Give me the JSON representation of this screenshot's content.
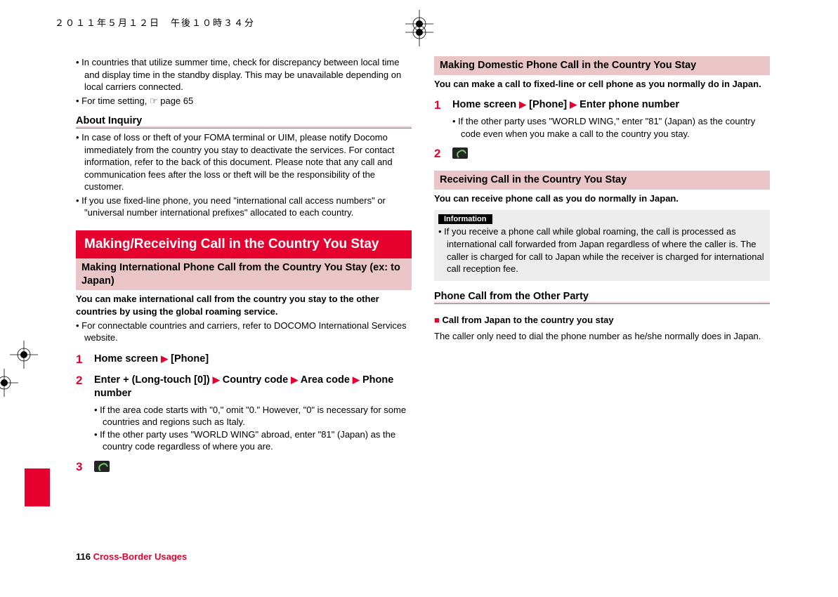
{
  "header": {
    "timestamp": "２０１１年５月１２日　午後１０時３４分"
  },
  "left": {
    "intro_bullets": [
      "In countries that utilize summer time, check for discrepancy between local time and display time in the standby display. This may be unavailable depending on local carriers connected.",
      "For time setting, ☞ page 65"
    ],
    "about_inquiry_h": "About Inquiry",
    "about_inquiry_bullets": [
      "In case of loss or theft of your FOMA terminal or UIM, please notify Docomo immediately from the country you stay to deactivate the services. For contact information, refer to the back of this document. Please note that any call and communication fees after the loss or theft will be the responsibility of the customer.",
      "If you use fixed-line phone, you need \"international call access numbers\" or \"universal number international prefixes\" allocated to each country."
    ],
    "h_red": "Making/Receiving Call in the Country You Stay",
    "h_pink1": "Making International Phone Call from the Country You Stay (ex: to Japan)",
    "intl_bold": "You can make international call from the country you stay to the other countries by using the global roaming service.",
    "intl_bullets": [
      "For connectable countries and carriers, refer to DOCOMO International Services website."
    ],
    "step1": {
      "num": "1",
      "parts": [
        "Home screen",
        "[Phone]"
      ]
    },
    "step2": {
      "num": "2",
      "parts": [
        "Enter + (Long-touch [0])",
        "Country code",
        "Area code",
        "Phone number"
      ],
      "sub": [
        "If the area code starts with \"0,\" omit \"0.\" However, \"0\" is necessary for some countries and regions such as Italy.",
        "If the other party uses \"WORLD WING\" abroad, enter \"81\" (Japan) as the country code regardless of where you are."
      ]
    },
    "step3_num": "3",
    "footer_page": "116",
    "footer_section": "Cross-Border Usages"
  },
  "right": {
    "h_pink2": "Making Domestic Phone Call in the Country You Stay",
    "dom_bold": "You can make a call to fixed-line or cell phone as you normally do in Japan.",
    "dom_step1": {
      "num": "1",
      "parts": [
        "Home screen",
        "[Phone]",
        "Enter phone number"
      ],
      "sub": [
        "If the other party uses \"WORLD WING,\" enter \"81\" (Japan) as the country code even when you make a call to the country you stay."
      ]
    },
    "dom_step2_num": "2",
    "h_pink3": "Receiving Call in the Country You Stay",
    "recv_bold": "You can receive phone call as you do normally in Japan.",
    "info_label": "Information",
    "info_bullets": [
      "If you receive a phone call while global roaming, the call is processed as international call forwarded from Japan regardless of where the caller is. The caller is charged for call to Japan while the receiver is charged for international call reception fee."
    ],
    "h_sub2": "Phone Call from the Other Party",
    "call_from_japan_h": "Call from Japan to the country you stay",
    "call_from_japan_body": "The caller only need to dial the phone number as he/she normally does in Japan."
  }
}
